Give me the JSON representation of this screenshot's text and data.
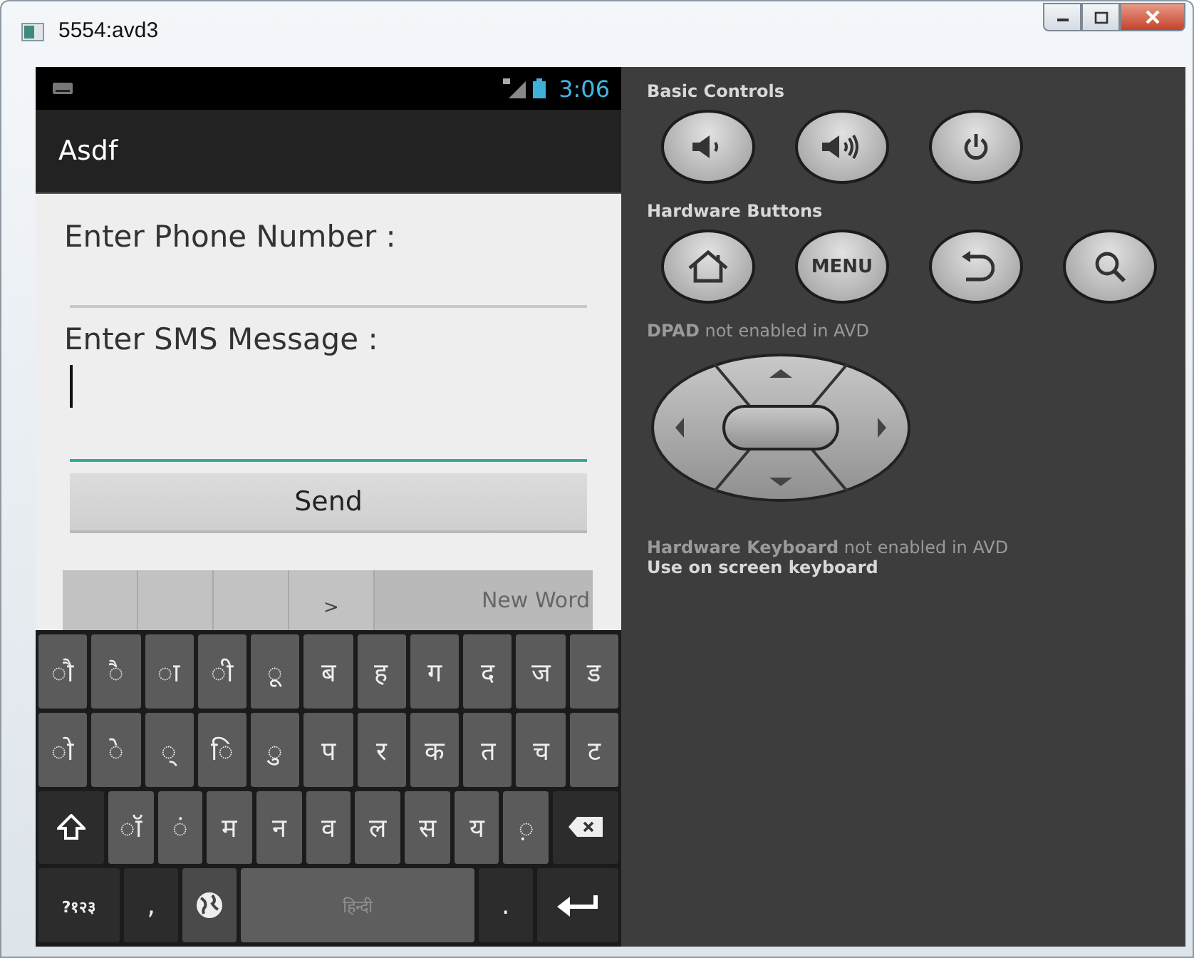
{
  "window": {
    "title": "5554:avd3",
    "controls": [
      {
        "kind": "minimize"
      },
      {
        "kind": "maximize"
      },
      {
        "kind": "close"
      }
    ]
  },
  "status_bar": {
    "time": "3:06"
  },
  "action_bar": {
    "title": "Asdf"
  },
  "form": {
    "fields": [
      {
        "label": "Enter Phone Number :",
        "focused": false
      },
      {
        "label": "Enter SMS Message :",
        "focused": true
      }
    ],
    "button": "Send"
  },
  "suggestions": [
    ">",
    "New Word"
  ],
  "keyboard": {
    "rows": [
      [
        {
          "kind": "char",
          "label": "ौ"
        },
        {
          "kind": "char",
          "label": "ै"
        },
        {
          "kind": "char",
          "label": "ा"
        },
        {
          "kind": "char",
          "label": "ी"
        },
        {
          "kind": "char",
          "label": "ू"
        },
        {
          "kind": "char",
          "label": "ब"
        },
        {
          "kind": "char",
          "label": "ह"
        },
        {
          "kind": "char",
          "label": "ग"
        },
        {
          "kind": "char",
          "label": "द"
        },
        {
          "kind": "char",
          "label": "ज"
        },
        {
          "kind": "char",
          "label": "ड"
        }
      ],
      [
        {
          "kind": "char",
          "label": "ो"
        },
        {
          "kind": "char",
          "label": "े"
        },
        {
          "kind": "char",
          "label": "्"
        },
        {
          "kind": "char",
          "label": "ि"
        },
        {
          "kind": "char",
          "label": "ु"
        },
        {
          "kind": "char",
          "label": "प"
        },
        {
          "kind": "char",
          "label": "र"
        },
        {
          "kind": "char",
          "label": "क"
        },
        {
          "kind": "char",
          "label": "त"
        },
        {
          "kind": "char",
          "label": "च"
        },
        {
          "kind": "char",
          "label": "ट"
        }
      ],
      [
        {
          "kind": "shift"
        },
        {
          "kind": "char",
          "label": "ॉ"
        },
        {
          "kind": "char",
          "label": "ं"
        },
        {
          "kind": "char",
          "label": "म"
        },
        {
          "kind": "char",
          "label": "न"
        },
        {
          "kind": "char",
          "label": "व"
        },
        {
          "kind": "char",
          "label": "ल"
        },
        {
          "kind": "char",
          "label": "स"
        },
        {
          "kind": "char",
          "label": "य"
        },
        {
          "kind": "char",
          "label": "़"
        },
        {
          "kind": "delete"
        }
      ],
      [
        {
          "kind": "symbols",
          "label": "?१२३"
        },
        {
          "kind": "punct",
          "label": ","
        },
        {
          "kind": "globe"
        },
        {
          "kind": "space",
          "label": "हिन्दी"
        },
        {
          "kind": "punct",
          "label": "."
        },
        {
          "kind": "enter"
        }
      ]
    ]
  },
  "panel": {
    "sections": [
      {
        "title": "Basic Controls",
        "buttons": [
          {
            "kind": "volume-down"
          },
          {
            "kind": "volume-up"
          },
          {
            "kind": "power"
          }
        ]
      },
      {
        "title": "Hardware Buttons",
        "buttons": [
          {
            "kind": "home"
          },
          {
            "kind": "menu",
            "label": "MENU"
          },
          {
            "kind": "back"
          },
          {
            "kind": "search"
          }
        ]
      }
    ],
    "dpad_note": "**DPAD** not enabled in AVD",
    "keyboard_notes": [
      {
        "text": "**Hardware Keyboard** not enabled in AVD",
        "emphasis": false
      },
      {
        "text": "Use on screen keyboard",
        "emphasis": true
      }
    ]
  }
}
